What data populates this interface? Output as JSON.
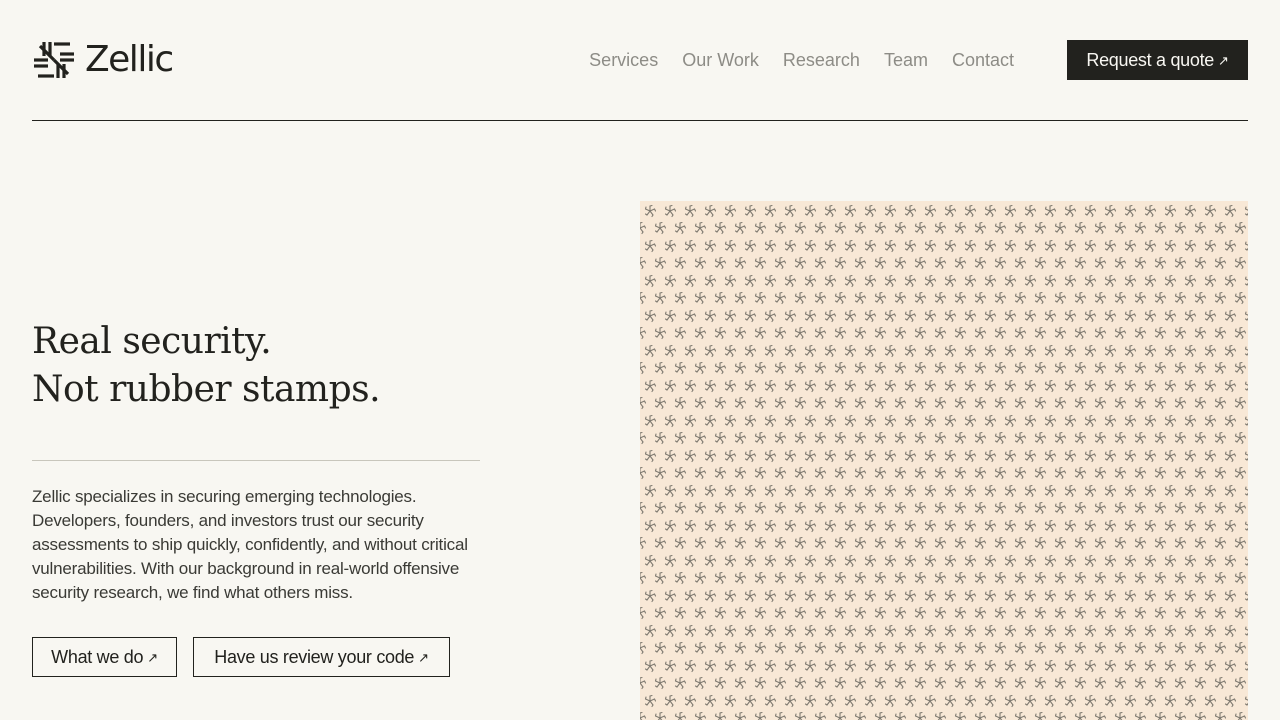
{
  "brand": {
    "name": "Zellic",
    "icon": "zellic-logo-icon"
  },
  "nav": {
    "items": [
      {
        "label": "Services"
      },
      {
        "label": "Our Work"
      },
      {
        "label": "Research"
      },
      {
        "label": "Team"
      },
      {
        "label": "Contact"
      }
    ],
    "cta_label": "Request a quote",
    "cta_icon": "arrow-up-right-icon"
  },
  "hero": {
    "headline_line1": "Real security.",
    "headline_line2": "Not rubber stamps.",
    "description": "Zellic specializes in securing emerging technologies. Developers, founders, and investors trust our security assessments to ship quickly, confidently, and without critical vulnerabilities. With our background in real-world offensive security research, we find what others miss.",
    "buttons": [
      {
        "label": "What we do",
        "icon": "arrow-up-right-icon"
      },
      {
        "label": "Have us review your code",
        "icon": "arrow-up-right-icon"
      }
    ]
  },
  "colors": {
    "background": "#f8f7f2",
    "ink": "#22221e",
    "nav_text": "#8d8c86",
    "pattern_bg": "#f8e8d6",
    "pattern_glyph": "#7f7a70"
  }
}
